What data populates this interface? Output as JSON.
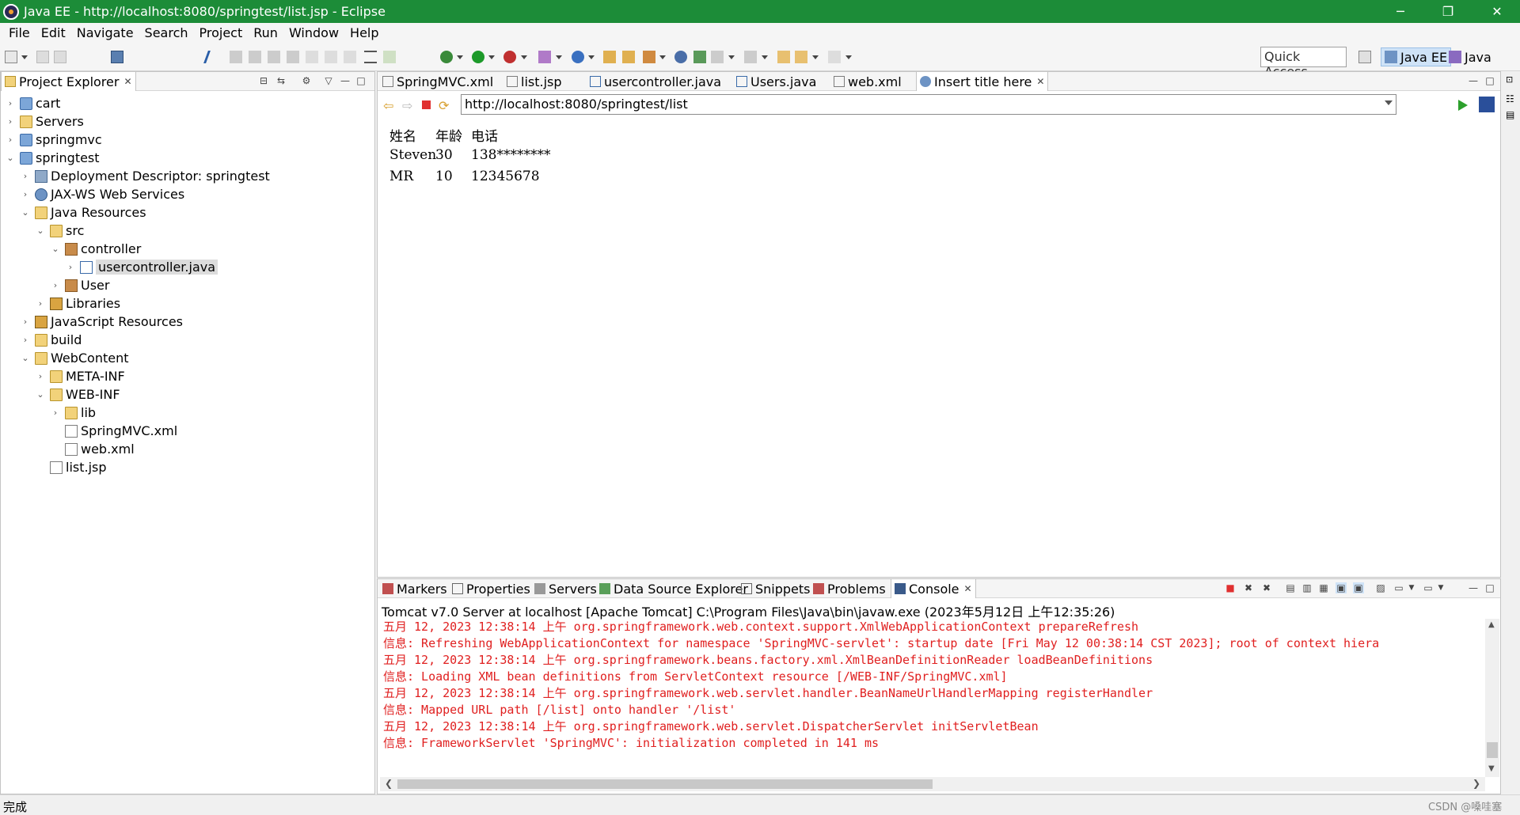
{
  "window": {
    "title": "Java EE - http://localhost:8080/springtest/list.jsp - Eclipse",
    "minimize": "─",
    "restore": "❐",
    "close": "✕"
  },
  "menu": [
    "File",
    "Edit",
    "Navigate",
    "Search",
    "Project",
    "Run",
    "Window",
    "Help"
  ],
  "toolbar": {
    "quick_access_placeholder": "Quick Access",
    "perspectives": [
      "Java EE",
      "Java"
    ]
  },
  "project_explorer": {
    "title": "Project Explorer",
    "items": [
      {
        "label": "cart",
        "icon": "project-icon",
        "expanded": false
      },
      {
        "label": "Servers",
        "icon": "folder-icon",
        "expanded": false
      },
      {
        "label": "springmvc",
        "icon": "project-icon",
        "expanded": false
      },
      {
        "label": "springtest",
        "icon": "project-icon",
        "expanded": true
      },
      {
        "label": "Deployment Descriptor: springtest",
        "icon": "deployment-descriptor-icon",
        "expanded": false
      },
      {
        "label": "JAX-WS Web Services",
        "icon": "web-services-icon",
        "expanded": false
      },
      {
        "label": "Java Resources",
        "icon": "folder-icon",
        "expanded": true
      },
      {
        "label": "src",
        "icon": "source-folder-icon",
        "expanded": true
      },
      {
        "label": "controller",
        "icon": "package-icon",
        "expanded": true
      },
      {
        "label": "usercontroller.java",
        "icon": "java-file-icon",
        "expanded": false
      },
      {
        "label": "User",
        "icon": "package-icon",
        "expanded": false
      },
      {
        "label": "Libraries",
        "icon": "library-icon",
        "expanded": false
      },
      {
        "label": "JavaScript Resources",
        "icon": "library-icon",
        "expanded": false
      },
      {
        "label": "build",
        "icon": "folder-icon",
        "expanded": false
      },
      {
        "label": "WebContent",
        "icon": "folder-icon",
        "expanded": true
      },
      {
        "label": "META-INF",
        "icon": "folder-icon",
        "expanded": false
      },
      {
        "label": "WEB-INF",
        "icon": "folder-icon",
        "expanded": true
      },
      {
        "label": "lib",
        "icon": "folder-icon",
        "expanded": false
      },
      {
        "label": "SpringMVC.xml",
        "icon": "xml-file-icon",
        "expanded": false
      },
      {
        "label": "web.xml",
        "icon": "xml-file-icon",
        "expanded": false
      },
      {
        "label": "list.jsp",
        "icon": "jsp-file-icon",
        "expanded": false
      }
    ]
  },
  "editor": {
    "tabs": [
      "SpringMVC.xml",
      "list.jsp",
      "usercontroller.java",
      "Users.java",
      "web.xml",
      "Insert title here"
    ],
    "active_tab": "Insert title here",
    "url": "http://localhost:8080/springtest/list",
    "table": {
      "headers": [
        "姓名",
        "年龄",
        "电话"
      ],
      "rows": [
        [
          "Steven",
          "30",
          "138********"
        ],
        [
          "MR",
          "10",
          "12345678"
        ]
      ]
    }
  },
  "console_panel": {
    "tabs": [
      "Markers",
      "Properties",
      "Servers",
      "Data Source Explorer",
      "Snippets",
      "Problems",
      "Console"
    ],
    "active_tab": "Console",
    "server_info": "Tomcat v7.0 Server at localhost [Apache Tomcat] C:\\Program Files\\Java\\bin\\javaw.exe (2023年5月12日 上午12:35:26)",
    "lines": [
      "五月 12, 2023 12:38:14 上午 org.springframework.web.context.support.XmlWebApplicationContext prepareRefresh",
      "信息: Refreshing WebApplicationContext for namespace 'SpringMVC-servlet': startup date [Fri May 12 00:38:14 CST 2023]; root of context hiera",
      "五月 12, 2023 12:38:14 上午 org.springframework.beans.factory.xml.XmlBeanDefinitionReader loadBeanDefinitions",
      "信息: Loading XML bean definitions from ServletContext resource [/WEB-INF/SpringMVC.xml]",
      "五月 12, 2023 12:38:14 上午 org.springframework.web.servlet.handler.BeanNameUrlHandlerMapping registerHandler",
      "信息: Mapped URL path [/list] onto handler '/list'",
      "五月 12, 2023 12:38:14 上午 org.springframework.web.servlet.DispatcherServlet initServletBean",
      "信息: FrameworkServlet 'SpringMVC': initialization completed in 141 ms"
    ],
    "text_color": "#e02020"
  },
  "status_bar": {
    "text": "完成",
    "watermark": "CSDN @嗓哇塞"
  }
}
